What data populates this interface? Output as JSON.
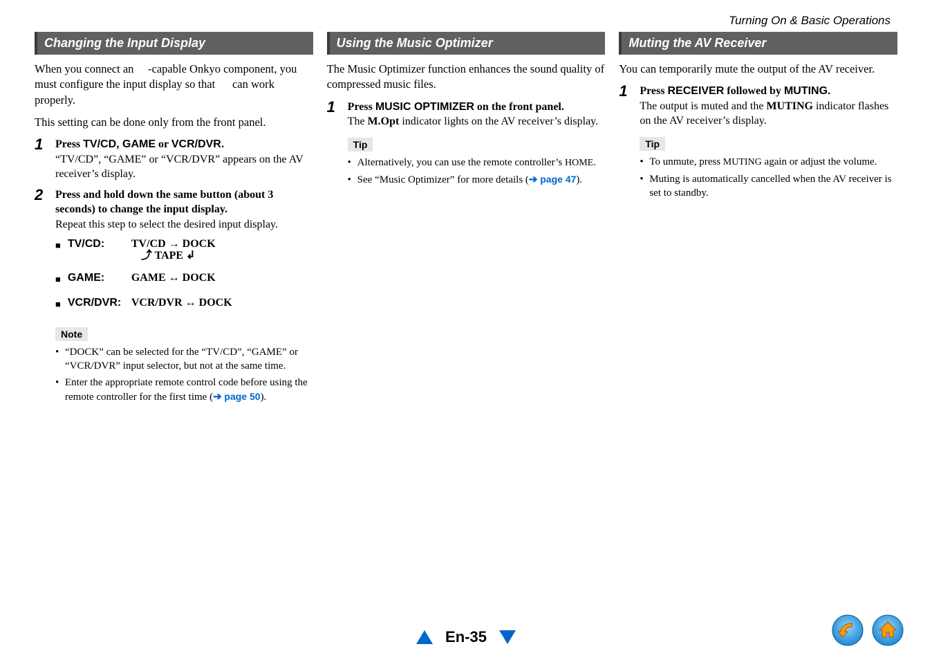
{
  "breadcrumb": "Turning On & Basic Operations",
  "col1": {
    "heading": "Changing the Input Display",
    "intro1": "When you connect an  -capable Onkyo component, you must configure the input display so that   can work properly.",
    "intro2": "This setting can be done only from the front panel.",
    "step1": {
      "num": "1",
      "line1a": "Press ",
      "line1b": "TV/CD, GAME",
      "line1c": " or ",
      "line1d": "VCR/DVR.",
      "line2": "“TV/CD”, “GAME” or “VCR/DVR” appears on the AV receiver’s display."
    },
    "step2": {
      "num": "2",
      "line1": "Press and hold down the same button (about 3 seconds) to change the input display.",
      "line2": "Repeat this step to select the desired input display."
    },
    "tvcd": {
      "label": "TV/CD:",
      "row1": "TV/CD  →  DOCK",
      "row2": "⤴  TAPE  ↲"
    },
    "game": {
      "label": "GAME:",
      "body": "GAME ↔ DOCK"
    },
    "vcr": {
      "label": "VCR/DVR:",
      "body": "VCR/DVR ↔ DOCK"
    },
    "noteLabel": "Note",
    "note1": "“DOCK” can be selected for the “TV/CD”, “GAME” or “VCR/DVR” input selector, but not at the same time.",
    "note2a": "Enter the appropriate remote control code before using the remote controller for the first time (",
    "note2link": "page 50",
    "note2b": ")."
  },
  "col2": {
    "heading": "Using the Music Optimizer",
    "intro": "The Music Optimizer function enhances the sound quality of compressed music files.",
    "step1": {
      "num": "1",
      "line1a": "Press ",
      "line1b": "MUSIC OPTIMIZER",
      "line1c": " on the front panel.",
      "line2a": "The ",
      "line2b": "M.Opt",
      "line2c": " indicator lights on the AV receiver’s display."
    },
    "tipLabel": "Tip",
    "tip1a": "Alternatively, you can use the remote controller’s ",
    "tip1b": "HOME",
    "tip1c": ".",
    "tip2a": "See “Music Optimizer” for more details (",
    "tip2link": "page 47",
    "tip2b": ")."
  },
  "col3": {
    "heading": "Muting the AV Receiver",
    "intro": "You can temporarily mute the output of the AV receiver.",
    "step1": {
      "num": "1",
      "line1a": "Press ",
      "line1b": "RECEIVER",
      "line1c": " followed by ",
      "line1d": "MUTING.",
      "line2a": "The output is muted and the ",
      "line2b": "MUTING",
      "line2c": " indicator flashes on the AV receiver’s display."
    },
    "tipLabel": "Tip",
    "tip1a": "To unmute, press ",
    "tip1b": "MUTING",
    "tip1c": " again or adjust the volume.",
    "tip2": "Muting is automatically cancelled when the AV receiver is set to standby."
  },
  "footer": {
    "pageNum": "En-35"
  }
}
